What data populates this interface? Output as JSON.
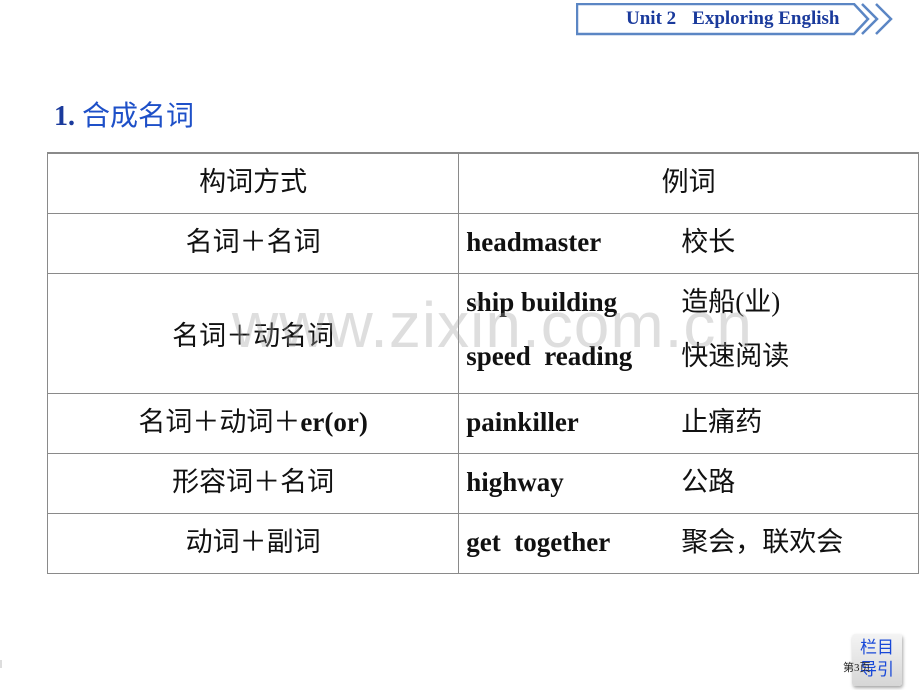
{
  "header": {
    "unit_label": "Unit 2",
    "unit_title": "Exploring English"
  },
  "section": {
    "number": "1.",
    "title": "合成名词"
  },
  "table": {
    "headers": [
      "构词方式",
      "例词"
    ],
    "rows": [
      {
        "formation": "名词＋名词",
        "examples": [
          {
            "en": "headmaster",
            "cn": "校长"
          }
        ]
      },
      {
        "formation": "名词＋动名词",
        "examples": [
          {
            "en": "ship building",
            "cn": "造船(业)"
          },
          {
            "en": "speed  reading",
            "cn": "快速阅读"
          }
        ]
      },
      {
        "formation_cn": "名词＋动词＋",
        "formation_en": "er(or)",
        "examples": [
          {
            "en": "painkiller",
            "cn": "止痛药"
          }
        ]
      },
      {
        "formation": "形容词＋名词",
        "examples": [
          {
            "en": "highway",
            "cn": "公路"
          }
        ]
      },
      {
        "formation": "动词＋副词",
        "examples": [
          {
            "en": "get  together",
            "cn": "聚会，联欢会"
          }
        ]
      }
    ]
  },
  "watermark": "www.zixin.com.cn",
  "nav": {
    "button_line1": "栏目",
    "button_line2": "导引",
    "page_label": "第3页"
  },
  "colors": {
    "banner_border": "#5b86c4",
    "title_blue": "#1e50c8",
    "nav_blue": "#1848d8"
  }
}
